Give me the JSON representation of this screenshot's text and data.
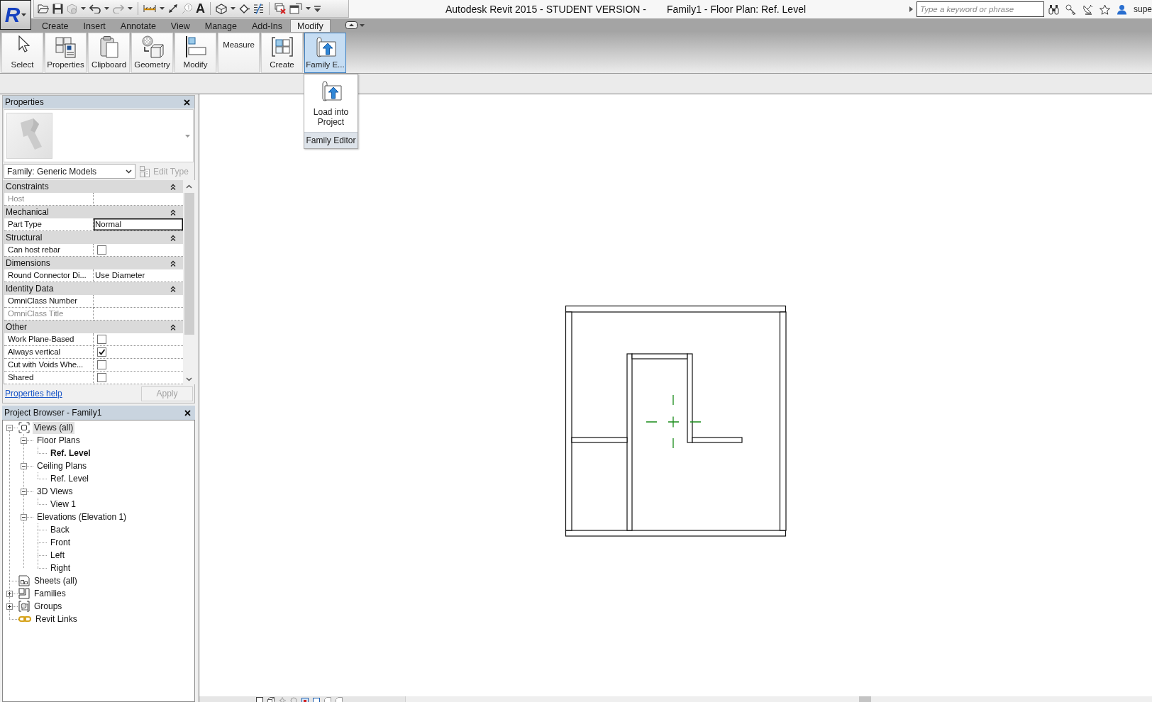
{
  "app_button": {
    "logo": "R"
  },
  "quick_access": {
    "text_label": "A"
  },
  "app": {
    "title": "Autodesk Revit 2015 - STUDENT VERSION -",
    "document": "Family1 - Floor Plan: Ref. Level"
  },
  "search": {
    "placeholder": "Type a keyword or phrase"
  },
  "user": {
    "name": "supe"
  },
  "ribbon_tabs": [
    {
      "label": "Create",
      "selected": false
    },
    {
      "label": "Insert",
      "selected": false
    },
    {
      "label": "Annotate",
      "selected": false
    },
    {
      "label": "View",
      "selected": false
    },
    {
      "label": "Manage",
      "selected": false
    },
    {
      "label": "Add-Ins",
      "selected": false
    },
    {
      "label": "Modify",
      "selected": true
    }
  ],
  "ribbon_panels": [
    {
      "label": "Select",
      "expanded": false
    },
    {
      "label": "Properties",
      "expanded": false
    },
    {
      "label": "Clipboard",
      "expanded": false
    },
    {
      "label": "Geometry",
      "expanded": false
    },
    {
      "label": "Modify",
      "expanded": false
    },
    {
      "label": "Measure",
      "expanded": false
    },
    {
      "label": "Create",
      "expanded": false
    },
    {
      "label": "Family E...",
      "expanded": true
    }
  ],
  "panel_dropdown": {
    "items": [
      {
        "label": "Load into Project"
      }
    ],
    "footer": "Family Editor"
  },
  "properties": {
    "title": "Properties",
    "type_selector": "Family: Generic Models",
    "edit_type": {
      "label": "Edit Type",
      "disabled": true
    },
    "groups": [
      {
        "name": "Constraints",
        "expanded": true,
        "rows": [
          {
            "label": "Host",
            "kind": "text",
            "disabled": true,
            "selected": false
          }
        ]
      },
      {
        "name": "Mechanical",
        "expanded": true,
        "rows": [
          {
            "label": "Part Type",
            "kind": "text",
            "value": "Normal",
            "disabled": false,
            "selected": true
          }
        ]
      },
      {
        "name": "Structural",
        "expanded": true,
        "rows": [
          {
            "label": "Can host rebar",
            "kind": "checkbox",
            "checked": false,
            "disabled": false,
            "selected": false
          }
        ]
      },
      {
        "name": "Dimensions",
        "expanded": true,
        "rows": [
          {
            "label": "Round Connector Di...",
            "kind": "text",
            "value": "Use Diameter",
            "disabled": false,
            "selected": false
          }
        ]
      },
      {
        "name": "Identity Data",
        "expanded": true,
        "rows": [
          {
            "label": "OmniClass Number",
            "kind": "text",
            "disabled": false,
            "selected": false
          },
          {
            "label": "OmniClass Title",
            "kind": "text",
            "disabled": true,
            "selected": false
          }
        ]
      },
      {
        "name": "Other",
        "expanded": true,
        "rows": [
          {
            "label": "Work Plane-Based",
            "kind": "checkbox",
            "checked": false,
            "disabled": false,
            "selected": false
          },
          {
            "label": "Always vertical",
            "kind": "checkbox",
            "checked": true,
            "disabled": false,
            "selected": false
          },
          {
            "label": "Cut with Voids Whe...",
            "kind": "checkbox",
            "checked": false,
            "disabled": false,
            "selected": false
          },
          {
            "label": "Shared",
            "kind": "checkbox",
            "checked": false,
            "disabled": false,
            "selected": false
          }
        ]
      }
    ],
    "help_link": "Properties help",
    "apply": {
      "label": "Apply",
      "disabled": true
    }
  },
  "project_browser": {
    "title": "Project Browser - Family1",
    "tree": [
      {
        "label": "Views (all)",
        "expanded": true,
        "selected": true,
        "children": [
          {
            "label": "Floor Plans",
            "expanded": true,
            "selected": false,
            "children": [
              {
                "label": "Ref. Level",
                "selected": false,
                "current": true
              }
            ]
          },
          {
            "label": "Ceiling Plans",
            "expanded": true,
            "selected": false,
            "children": [
              {
                "label": "Ref. Level",
                "selected": false,
                "current": false
              }
            ]
          },
          {
            "label": "3D Views",
            "expanded": true,
            "selected": false,
            "children": [
              {
                "label": "View 1",
                "selected": false,
                "current": false
              }
            ]
          },
          {
            "label": "Elevations (Elevation 1)",
            "expanded": true,
            "selected": false,
            "children": [
              {
                "label": "Back",
                "selected": false,
                "current": false
              },
              {
                "label": "Front",
                "selected": false,
                "current": false
              },
              {
                "label": "Left",
                "selected": false,
                "current": false
              },
              {
                "label": "Right",
                "selected": false,
                "current": false
              }
            ]
          }
        ]
      },
      {
        "label": "Sheets (all)",
        "selected": false
      },
      {
        "label": "Families",
        "expanded": false,
        "selected": false
      },
      {
        "label": "Groups",
        "expanded": false,
        "selected": false
      },
      {
        "label": "Revit Links",
        "selected": false
      }
    ]
  }
}
